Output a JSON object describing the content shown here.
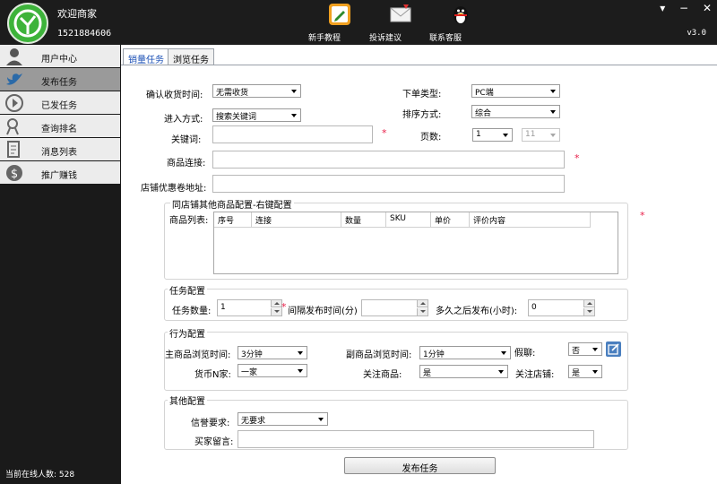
{
  "header": {
    "welcome": "欢迎商家",
    "phone": "1521884606",
    "version": "v3.0",
    "tools": [
      {
        "label": "新手教程",
        "icon": "edit-icon"
      },
      {
        "label": "投诉建议",
        "icon": "mail-icon"
      },
      {
        "label": "联系客服",
        "icon": "qq-penguin-icon"
      }
    ]
  },
  "sidebar": {
    "items": [
      {
        "label": "用户中心",
        "icon": "user-icon"
      },
      {
        "label": "发布任务",
        "icon": "bird-icon"
      },
      {
        "label": "已发任务",
        "icon": "play-circle-icon"
      },
      {
        "label": "查询排名",
        "icon": "search-rank-icon"
      },
      {
        "label": "消息列表",
        "icon": "document-icon"
      },
      {
        "label": "推广赚钱",
        "icon": "dollar-icon"
      }
    ],
    "active_index": 1,
    "online_label": "当前在线人数:",
    "online_count": "528"
  },
  "tabs": [
    "销量任务",
    "浏览任务"
  ],
  "form": {
    "confirm_time": {
      "label": "确认收货时间:",
      "value": "无需收货"
    },
    "order_type": {
      "label": "下单类型:",
      "value": "PC端"
    },
    "entry_method": {
      "label": "进入方式:",
      "value": "搜索关键词"
    },
    "sort_method": {
      "label": "排序方式:",
      "value": "综合"
    },
    "keyword": {
      "label": "关键词:",
      "value": ""
    },
    "page_count": {
      "label": "页数:",
      "from": "1",
      "to": "11"
    },
    "product_link": {
      "label": "商品连接:",
      "value": ""
    },
    "coupon_url": {
      "label": "店铺优惠卷地址:",
      "value": ""
    },
    "required_mark": "*"
  },
  "same_store": {
    "title": "同店铺其他商品配置-右键配置",
    "list_label": "商品列表:",
    "columns": [
      "序号",
      "连接",
      "数量",
      "SKU",
      "单价",
      "评价内容"
    ]
  },
  "task_config": {
    "title": "任务配置",
    "quantity_label": "任务数量:",
    "quantity": "1",
    "interval_label": "间隔发布时间(分)",
    "interval": "",
    "delay_label": "多久之后发布(小时):",
    "delay": "0"
  },
  "behavior": {
    "title": "行为配置",
    "main_browse": {
      "label": "主商品浏览时间:",
      "value": "3分钟"
    },
    "sub_browse": {
      "label": "副商品浏览时间:",
      "value": "1分钟"
    },
    "fake_chat": {
      "label": "假聊:",
      "value": "否"
    },
    "compare": {
      "label": "货币N家:",
      "value": "一家"
    },
    "follow_product": {
      "label": "关注商品:",
      "value": "是"
    },
    "follow_store": {
      "label": "关注店铺:",
      "value": "是"
    }
  },
  "other": {
    "title": "其他配置",
    "reputation": {
      "label": "信誉要求:",
      "value": "无要求"
    },
    "buyer_message": {
      "label": "买家留言:",
      "value": ""
    }
  },
  "submit_label": "发布任务",
  "colors": {
    "accent_tab": "#1a4fb5",
    "required": "#e8204a",
    "logo": "#3db33a"
  }
}
